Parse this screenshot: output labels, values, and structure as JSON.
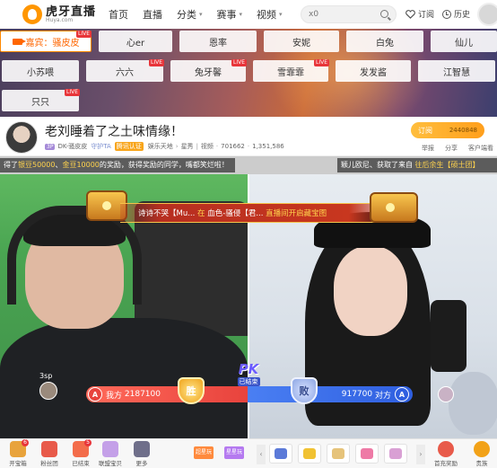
{
  "logo": {
    "title": "虎牙直播",
    "sub": "Huya.com"
  },
  "nav": {
    "items": [
      {
        "label": "首页",
        "caret": false
      },
      {
        "label": "直播",
        "caret": false
      },
      {
        "label": "分类",
        "caret": true
      },
      {
        "label": "赛事",
        "caret": true
      },
      {
        "label": "视频",
        "caret": true
      }
    ]
  },
  "search": {
    "value": "",
    "placeholder": "x0"
  },
  "topbar": {
    "follow": "订阅",
    "history": "历史"
  },
  "rooms": [
    {
      "label": "嘉宾：骚皮皮",
      "live": true,
      "active": true
    },
    {
      "label": "心er",
      "live": false,
      "active": false
    },
    {
      "label": "恩率",
      "live": false,
      "active": false
    },
    {
      "label": "安妮",
      "live": false,
      "active": false
    },
    {
      "label": "白兔",
      "live": false,
      "active": false
    },
    {
      "label": "仙儿",
      "live": false,
      "active": false
    },
    {
      "label": "小苏喂",
      "live": false,
      "active": false
    },
    {
      "label": "六六",
      "live": true,
      "active": false
    },
    {
      "label": "兔牙馨",
      "live": true,
      "active": false
    },
    {
      "label": "雪霏霏",
      "live": true,
      "active": false
    },
    {
      "label": "发发酱",
      "live": false,
      "active": false
    },
    {
      "label": "江智慧",
      "live": false,
      "active": false
    },
    {
      "label": "只只",
      "live": true,
      "active": false
    }
  ],
  "live_tag": "LIVE",
  "stream": {
    "title": "老刘睡着了之土味情缘！",
    "level": "3P",
    "host": "DK-骚皮皮",
    "guard": "守护TA",
    "verify": "腾讯认证",
    "category": "娱乐天地",
    "subcategory": "星秀",
    "report_video": "视频",
    "count_a": "701662",
    "count_b": "1,351,586",
    "follow_label": "订阅",
    "follow_count": "2440848",
    "actions": [
      "举报",
      "分享",
      "客户端看"
    ]
  },
  "video": {
    "marquee_left_parts": [
      {
        "t": "得了",
        "em": false
      },
      {
        "t": "银豆50000",
        "em": true
      },
      {
        "t": "、",
        "em": false
      },
      {
        "t": "金豆10000",
        "em": true
      },
      {
        "t": "的奖励，获得奖励的同学，嘴都笑烂啦！",
        "em": false
      }
    ],
    "marquee_right_parts": [
      {
        "t": "颖儿欧尼、获取了来自 ",
        "em": false
      },
      {
        "t": "往后余生【硕士团】",
        "em": true
      }
    ],
    "treasure_parts": [
      {
        "t": "诗诗不哭【Mu... ",
        "em": false
      },
      {
        "t": "在",
        "em": true
      },
      {
        "t": " 血色-骚侵【君... ",
        "em": false
      },
      {
        "t": "直播间开启藏宝图",
        "em": true
      }
    ],
    "left_user": "3sp",
    "pk": {
      "left_side": "A",
      "left_label": "我方",
      "left_score": "2187100",
      "win": "胜",
      "lose": "败",
      "right_score": "917700",
      "right_label": "对方",
      "right_side": "A",
      "logo": "PK",
      "status": "已结束"
    }
  },
  "toolbar": {
    "tools": [
      {
        "label": "开宝箱",
        "badge": "6",
        "color": "#e8a33c"
      },
      {
        "label": "粉丝团",
        "badge": "",
        "color": "#e85a4a"
      },
      {
        "label": "已结束",
        "badge": "5",
        "color": "#f36d4b"
      },
      {
        "label": "联盟宝贝",
        "badge": "",
        "color": "#c4a0e8"
      },
      {
        "label": "更多",
        "badge": "",
        "color": "#6f6f8a"
      }
    ],
    "promos": [
      "超星玩",
      "星星玩"
    ],
    "gifts": [
      "gift-1",
      "gift-2",
      "gift-3",
      "gift-4",
      "gift-5"
    ],
    "right_tools": [
      {
        "label": "首充奖励",
        "color": "#e85a4a"
      },
      {
        "label": "贵族",
        "color": "#f2a218"
      }
    ],
    "arrow_left": "‹",
    "arrow_right": "›"
  }
}
